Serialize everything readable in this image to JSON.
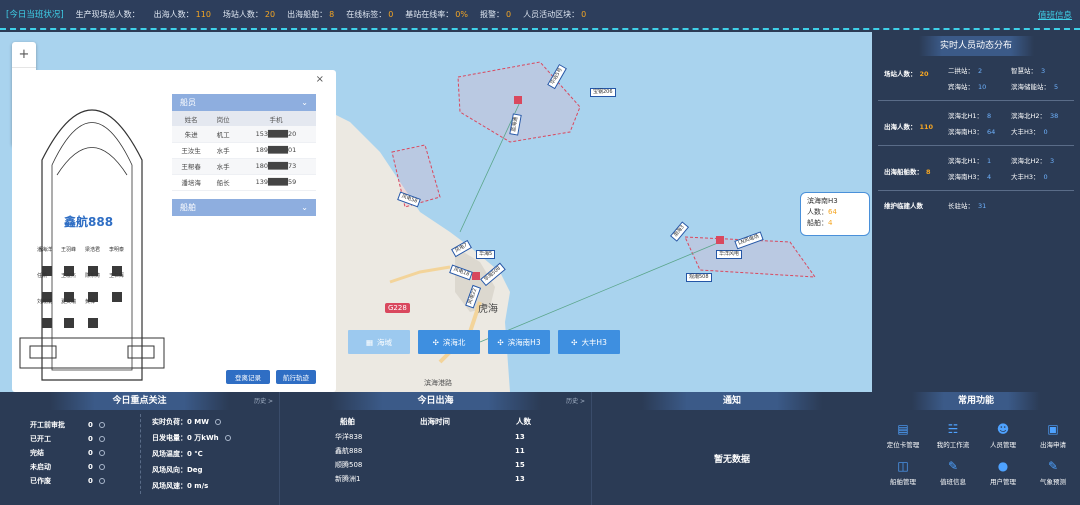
{
  "header": {
    "title": "[今日当班状况]",
    "stats": [
      {
        "label": "生产现场总人数：",
        "value": ""
      },
      {
        "label": "出海人数：",
        "value": "110"
      },
      {
        "label": "场站人数：",
        "value": "20"
      },
      {
        "label": "出海船舶：",
        "value": "8"
      },
      {
        "label": "在线标签：",
        "value": "0"
      },
      {
        "label": "基站在线率：",
        "value": "0%"
      },
      {
        "label": "报警：",
        "value": "0"
      },
      {
        "label": "人员活动区块：",
        "value": "0"
      }
    ],
    "switch_label": "值班信息"
  },
  "map": {
    "zoom_in": "+",
    "zoom_out": "−",
    "labels": [
      "宝钢206",
      "华远5号",
      "蓝海通",
      "风电58",
      "风电7",
      "华海5",
      "风电18",
      "华海508",
      "风电22",
      "渤海3",
      "LN风电场",
      "华洋风电",
      "观潮508"
    ],
    "place_label": "虎海",
    "road_label": "G228",
    "road_label2": "滨海港路",
    "callout": {
      "title": "滨海南H3",
      "people_label": "人数：",
      "people": "64",
      "ships_label": "船舶：",
      "ships": "4"
    },
    "buttons": [
      {
        "label": "海域",
        "icon": "building-icon"
      },
      {
        "label": "滨海北",
        "icon": "turbine-icon"
      },
      {
        "label": "滨海南H3",
        "icon": "turbine-icon"
      },
      {
        "label": "大丰H3",
        "icon": "turbine-icon"
      }
    ]
  },
  "vessel_popup": {
    "close": "×",
    "ship_name": "鑫航888",
    "seats": [
      "潘海洋",
      "王羽峰",
      "梁浩君",
      "李明泰",
      "任凯",
      "王宏杰",
      "陈东涛",
      "王仁辉",
      "刘成斌",
      "夏文瑞",
      "黄祥"
    ],
    "crew_header": "船员",
    "crew_columns": [
      "姓名",
      "岗位",
      "手机"
    ],
    "crew": [
      {
        "name": "朱进",
        "role": "机工",
        "phone": "153████20"
      },
      {
        "name": "王汝生",
        "role": "水手",
        "phone": "189████01"
      },
      {
        "name": "王帮春",
        "role": "水手",
        "phone": "180████73"
      },
      {
        "name": "潘培海",
        "role": "船长",
        "phone": "139████59"
      }
    ],
    "ship_header": "船舶",
    "btn_records": "登离记录",
    "btn_track": "航行轨迹"
  },
  "right_panel": {
    "title": "实时人员动态分布",
    "sections": [
      {
        "label": "场站人数：",
        "value": "20",
        "rows": [
          [
            {
              "k": "二拱站：",
              "v": "2"
            },
            {
              "k": "智慧站：",
              "v": "3"
            }
          ],
          [
            {
              "k": "宾海站：",
              "v": "10"
            },
            {
              "k": "滨海储能站：",
              "v": "5"
            }
          ]
        ]
      },
      {
        "label": "出海人数：",
        "value": "110",
        "rows": [
          [
            {
              "k": "滨海北H1：",
              "v": "8"
            },
            {
              "k": "滨海北H2：",
              "v": "38"
            }
          ],
          [
            {
              "k": "滨海南H3：",
              "v": "64"
            },
            {
              "k": "大丰H3：",
              "v": "0"
            }
          ]
        ]
      },
      {
        "label": "出海船舶数：",
        "value": "8",
        "rows": [
          [
            {
              "k": "滨海北H1：",
              "v": "1"
            },
            {
              "k": "滨海北H2：",
              "v": "3"
            }
          ],
          [
            {
              "k": "滨海南H3：",
              "v": "4"
            },
            {
              "k": "大丰H3：",
              "v": "0"
            }
          ]
        ]
      },
      {
        "label": "维护临建人数",
        "value": "",
        "rows": [
          [
            {
              "k": "长驻站：",
              "v": "31"
            }
          ]
        ]
      }
    ]
  },
  "focus": {
    "title": "今日重点关注",
    "history": "历史 >",
    "left": [
      {
        "label": "开工前审批",
        "value": "0"
      },
      {
        "label": "已开工",
        "value": "0"
      },
      {
        "label": "完结",
        "value": "0"
      },
      {
        "label": "未启动",
        "value": "0"
      },
      {
        "label": "已作废",
        "value": "0"
      }
    ],
    "right": [
      {
        "label": "实时负荷：",
        "value": "0 MW"
      },
      {
        "label": "日发电量：",
        "value": "0 万kWh"
      },
      {
        "label": "风场温度：",
        "value": "0 ℃"
      },
      {
        "label": "风场风向：",
        "value": "Deg"
      },
      {
        "label": "风场风速：",
        "value": "0 m/s"
      }
    ]
  },
  "sea_today": {
    "title": "今日出海",
    "history": "历史 >",
    "columns": [
      "船舶",
      "出海时间",
      "人数"
    ],
    "rows": [
      {
        "ship": "华洋838",
        "time": "",
        "count": "13"
      },
      {
        "ship": "鑫航888",
        "time": "",
        "count": "11"
      },
      {
        "ship": "顺腾508",
        "time": "",
        "count": "15"
      },
      {
        "ship": "新腾洲1",
        "time": "",
        "count": "13"
      }
    ]
  },
  "notice": {
    "title": "通知",
    "empty": "暂无数据"
  },
  "functions": {
    "title": "常用功能",
    "items": [
      {
        "label": "定位卡管理",
        "icon": "card-icon"
      },
      {
        "label": "我的工作流",
        "icon": "workflow-icon"
      },
      {
        "label": "人员管理",
        "icon": "people-icon"
      },
      {
        "label": "出海申请",
        "icon": "form-icon"
      },
      {
        "label": "船舶管理",
        "icon": "ship-icon"
      },
      {
        "label": "值班信息",
        "icon": "edit-icon"
      },
      {
        "label": "用户管理",
        "icon": "user-icon"
      },
      {
        "label": "气象预测",
        "icon": "edit-icon"
      }
    ]
  },
  "colors": {
    "accent": "#3fd0e8",
    "warn": "#f5a623",
    "link": "#6fb3ff",
    "panel": "#2b3b55"
  }
}
